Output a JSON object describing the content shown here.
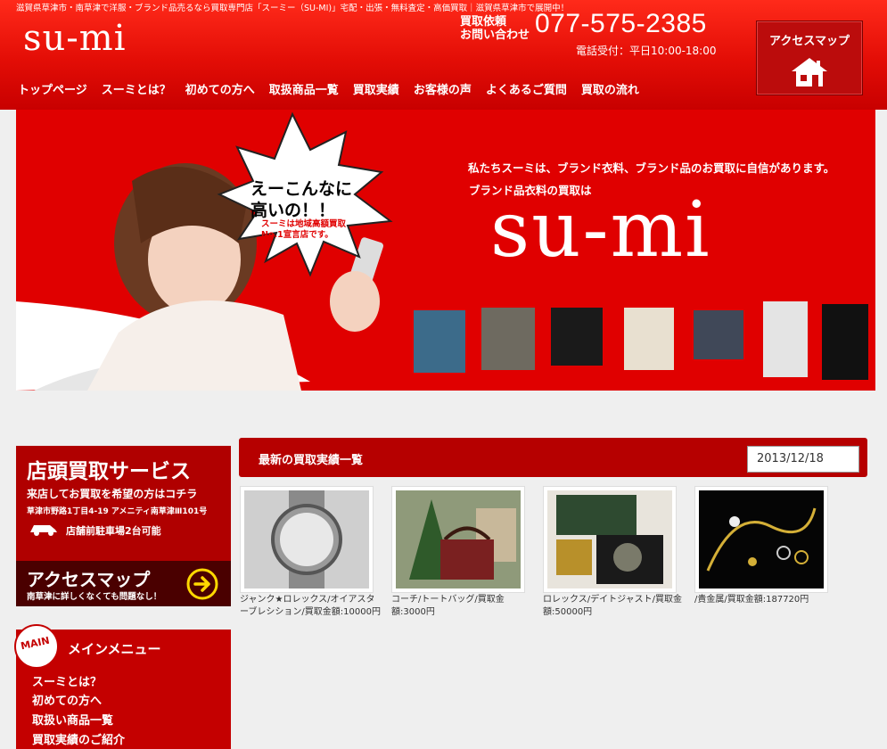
{
  "header": {
    "tagline": "滋賀県草津市・南草津で洋服・ブランド品売るなら買取専門店「スーミー（SU-MI)」宅配・出張・無料査定・高価買取｜滋賀県草津市で展開中！",
    "logo": "su-mi",
    "contact_label_1": "買取依頼",
    "contact_label_2": "お問い合わせ",
    "phone": "077-575-2385",
    "hours": "電話受付：平日10:00-18:00",
    "access_label": "アクセスマップ"
  },
  "nav": [
    "トップページ",
    "スーミとは？",
    "初めての方へ",
    "取扱商品一覧",
    "買取実績",
    "お客様の声",
    "よくあるご質問",
    "買取の流れ"
  ],
  "hero": {
    "copy1": "私たちスーミは、ブランド衣料、ブランド品のお買取に自信があります。",
    "copy2": "ブランド品衣料の買取は",
    "logo": "su-mi",
    "bubble_line1": "えーこんなに",
    "bubble_line2": "高いの！！",
    "bubble_small1": "スーミは地域高額買取",
    "bubble_small2": "No.1宣言店です。"
  },
  "store_box": {
    "title": "店頭買取サービス",
    "subtitle": "来店してお買取を希望の方はコチラ",
    "address": "草津市野路1丁目4-19 アメニティ南草津Ⅲ101号",
    "parking": "店舗前駐車場2台可能",
    "access_title": "アクセスマップ",
    "access_sub": "南草津に詳しくなくても問題なし！"
  },
  "main_menu": {
    "badge": "MAIN",
    "title": "メインメニュー",
    "items": [
      "スーミとは？",
      "初めての方へ",
      "取扱い商品一覧",
      "買取実績のご紹介"
    ]
  },
  "results": {
    "title": "最新の買取実績一覧",
    "date": "2013/12/18",
    "items": [
      {
        "caption": "ジャンク★ロレックス/オイアスターブレシション/買取金額:10000円",
        "image": "watch-photo"
      },
      {
        "caption": "コーチ/トートバッグ/買取金額:3000円",
        "image": "bag-photo"
      },
      {
        "caption": "ロレックス/デイトジャスト/買取金額:50000円",
        "image": "rolex-box-photo"
      },
      {
        "caption": "/貴金属/買取金額:187720円",
        "image": "jewelry-photo"
      }
    ]
  },
  "colors": {
    "brand_red": "#e00000",
    "dark_red": "#b00000"
  }
}
